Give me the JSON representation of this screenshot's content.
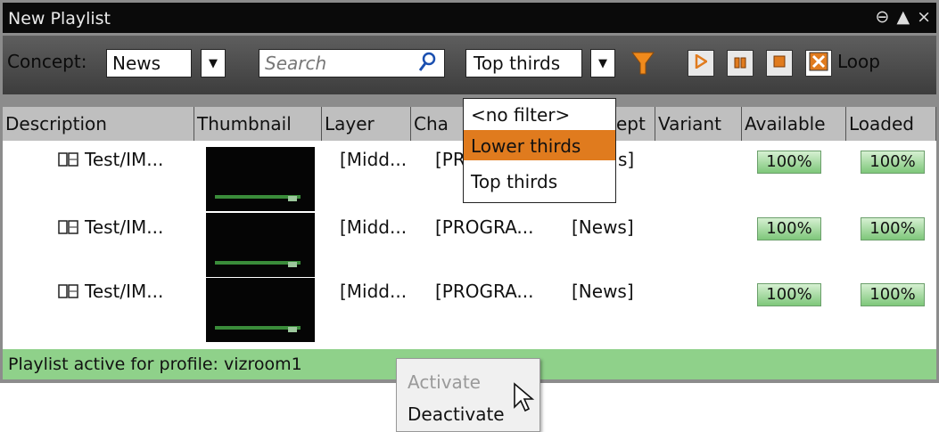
{
  "window": {
    "title": "New Playlist",
    "controls": [
      "⊖",
      "▲",
      "×"
    ]
  },
  "toolbar": {
    "concept_label": "Concept:",
    "concept_value": "News",
    "search_placeholder": "Search",
    "filter_value": "Top thirds",
    "loop_label": "Loop"
  },
  "table": {
    "columns": [
      "Description",
      "Thumbnail",
      "Layer",
      "Channel",
      "Concept",
      "Variant",
      "Available",
      "Loaded"
    ],
    "column_partial": {
      "channel": "Cha",
      "concept": "ept"
    },
    "rows": [
      {
        "description": "Test/IM...",
        "layer": "[Midd...",
        "channel": "[PR",
        "concept": "s]",
        "available": "100%",
        "loaded": "100%"
      },
      {
        "description": "Test/IM...",
        "layer": "[Midd...",
        "channel": "[PROGRA...",
        "concept": "[News]",
        "available": "100%",
        "loaded": "100%"
      },
      {
        "description": "Test/IM...",
        "layer": "[Midd...",
        "channel": "[PROGRA...",
        "concept": "[News]",
        "available": "100%",
        "loaded": "100%"
      }
    ]
  },
  "filter_dropdown": {
    "options": [
      "<no filter>",
      "Lower thirds",
      "Top thirds"
    ],
    "highlighted": "Lower thirds"
  },
  "status": {
    "text": "Playlist active for profile: vizroom1"
  },
  "context_menu": {
    "items": [
      {
        "label": "Activate",
        "enabled": false
      },
      {
        "label": "Deactivate",
        "enabled": true
      }
    ]
  },
  "colors": {
    "title_bg": "#0a0a0a",
    "highlight": "#e07b1e",
    "status_bg": "#8fd18a",
    "play_icon": "#f08a1c",
    "loop_check": "#e07b1e"
  }
}
